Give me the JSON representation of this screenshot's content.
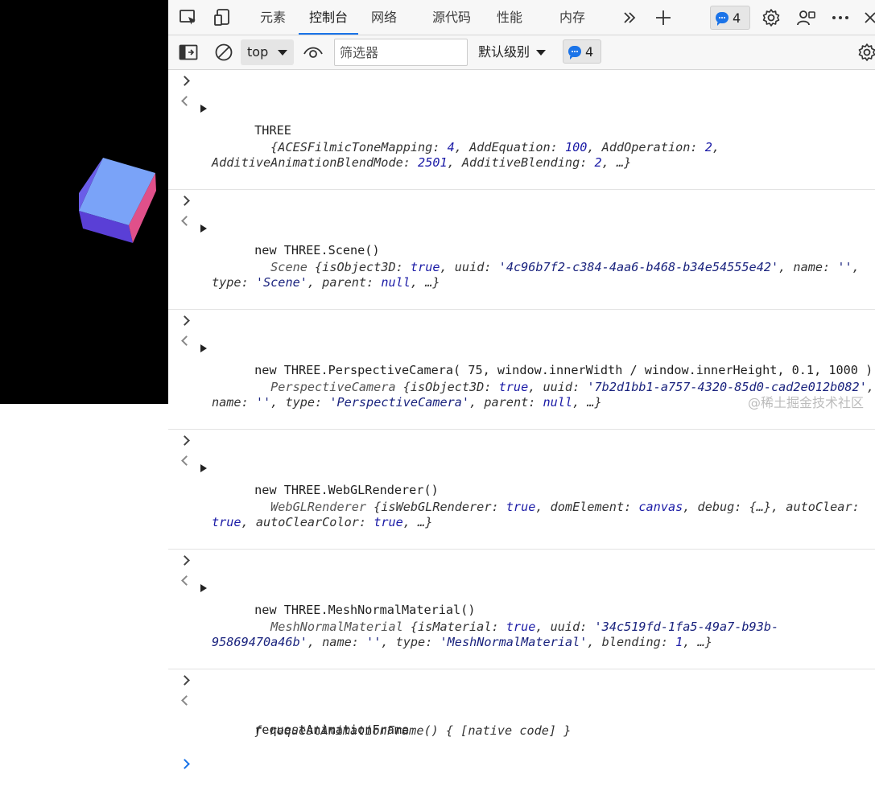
{
  "tabs": [
    "元素",
    "控制台",
    "网络",
    "源代码",
    "性能",
    "内存"
  ],
  "active_tab": "控制台",
  "issues_count": "4",
  "console_toolbar": {
    "context": "top",
    "filter_placeholder": "筛选器",
    "levels_label": "默认级别",
    "messages_count": "4"
  },
  "entries": [
    {
      "input": "THREE",
      "result_parts": [
        "{ACESFilmicToneMapping",
        ": ",
        "4",
        ", AddEquation",
        ": ",
        "100",
        ", AddOperation",
        ": ",
        "2",
        ", AdditiveAnimationBlendMode",
        ": ",
        "2501",
        ", AdditiveBlending",
        ": ",
        "2",
        ", …}"
      ]
    },
    {
      "input": "new THREE.Scene()",
      "result_parts": [
        "Scene ",
        "{isObject3D",
        ": ",
        "true",
        ", uuid",
        ": ",
        "'4c96b7f2-c384-4aa6-b468-b34e54555e42'",
        ", name",
        ": ",
        "''",
        ", type",
        ": ",
        "'Scene'",
        ", parent",
        ": ",
        "null",
        ", …}"
      ]
    },
    {
      "input": "new THREE.PerspectiveCamera( 75, window.innerWidth / window.innerHeight, 0.1, 1000 )",
      "result_parts": [
        "PerspectiveCamera ",
        "{isObject3D",
        ": ",
        "true",
        ", uuid",
        ": ",
        "'7b2d1bb1-a757-4320-85d0-cad2e012b082'",
        ", name",
        ": ",
        "''",
        ", type",
        ": ",
        "'PerspectiveCamera'",
        ", parent",
        ": ",
        "null",
        ", …}"
      ]
    },
    {
      "input": "new THREE.WebGLRenderer()",
      "result_parts": [
        "WebGLRenderer ",
        "{isWebGLRenderer",
        ": ",
        "true",
        ", domElement",
        ": ",
        "canvas",
        ", debug",
        ": ",
        "{…}",
        ", autoClear",
        ": ",
        "true",
        ", autoClearColor",
        ": ",
        "true",
        ", …}"
      ]
    },
    {
      "input": "new THREE.MeshNormalMaterial()",
      "result_parts": [
        "MeshNormalMaterial ",
        "{isMaterial",
        ": ",
        "true",
        ", uuid",
        ": ",
        "'34c519fd-1fa5-49a7-b93b-95869470a46b'",
        ", name",
        ": ",
        "''",
        ", type",
        ": ",
        "'MeshNormalMaterial'",
        ", blending",
        ": ",
        "1",
        ", …}"
      ]
    },
    {
      "input": "requestAnimationFrame",
      "result_parts": [
        "ƒ requestAnimationFrame() { [native code] }"
      ]
    }
  ],
  "watermark": "@稀土掘金技术社区",
  "colors": {
    "accent": "#1a73e8",
    "keyword": "#8b1a86",
    "string": "#1a237e",
    "value": "#1a1aa6"
  }
}
